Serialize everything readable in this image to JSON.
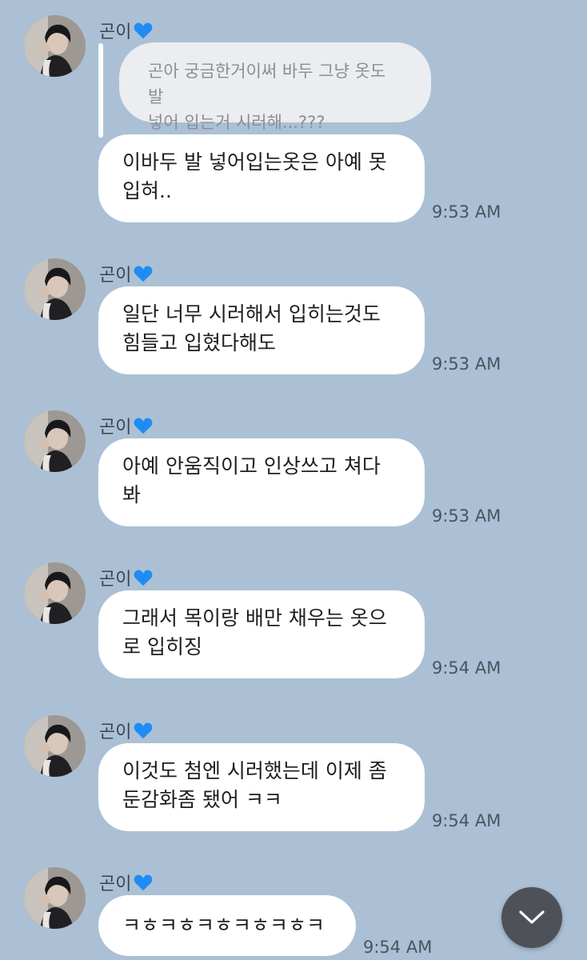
{
  "sender": {
    "name": "곤이",
    "heart_icon": "blue-heart-icon",
    "heart_color": "#1e8cf5"
  },
  "messages": [
    {
      "quote": "곤아 궁금한거이써 바두 그냥 옷도 발\n넣어 입는거 시러해...???",
      "text": "이바두 발 넣어입는옷은 아예 못\n입혀..",
      "time": "9:53 AM"
    },
    {
      "text": "일단 너무 시러해서 입히는것도\n힘들고 입혔다해도",
      "time": "9:53 AM"
    },
    {
      "text": "아예 안움직이고 인상쓰고 쳐다\n봐",
      "time": "9:53 AM"
    },
    {
      "text": "그래서 목이랑 배만 채우는 옷으\n로 입히징",
      "time": "9:54 AM"
    },
    {
      "text": "이것도 첨엔 시러했는데 이제 좀\n둔감화좀 됐어 ㅋㅋ",
      "time": "9:54 AM"
    },
    {
      "text": "ㅋㅎㅋㅎㅋㅎㅋㅎㅋㅎㅋ",
      "time": "9:54 AM"
    }
  ],
  "colors": {
    "background": "#abc0d4",
    "bubble": "#ffffff",
    "quote_bubble": "#ebedf0",
    "scroll_button": "#4e5258"
  },
  "scroll_button_icon": "chevron-down-icon"
}
